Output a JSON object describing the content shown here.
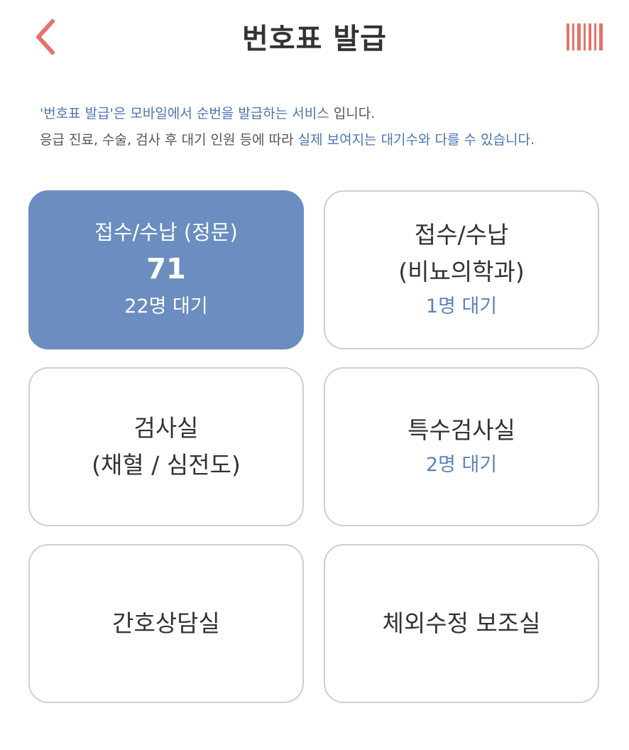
{
  "colors": {
    "accent": "#e57368",
    "highlight": "#4a74b3",
    "active_card": "#6b8dbf",
    "wait_text": "#5b83bd",
    "border": "#cfcfcf"
  },
  "header": {
    "title": "번호표 발급",
    "back_icon": "chevron-left-icon",
    "barcode_icon": "barcode-icon"
  },
  "notice": {
    "line1_highlight": "'번호표 발급'은 모바일에서 순번을 발급하는 서비스",
    "line1_rest": " 입니다.",
    "line2_plain": "응급 진료, 수술, 검사 후 대기 인원 등에 따라 ",
    "line2_highlight": "실제 보여지는 대기수와 다를 수 있습니다."
  },
  "cards": [
    {
      "title": "접수/수납 (정문)",
      "number": "71",
      "wait": "22명 대기",
      "active": true
    },
    {
      "title_line1": "접수/수납",
      "title_line2": "(비뇨의학과)",
      "wait": "1명 대기"
    },
    {
      "title_line1": "검사실",
      "title_line2": "(채혈 / 심전도)"
    },
    {
      "title": "특수검사실",
      "wait": "2명 대기"
    },
    {
      "title": "간호상담실"
    },
    {
      "title": "체외수정 보조실"
    }
  ]
}
